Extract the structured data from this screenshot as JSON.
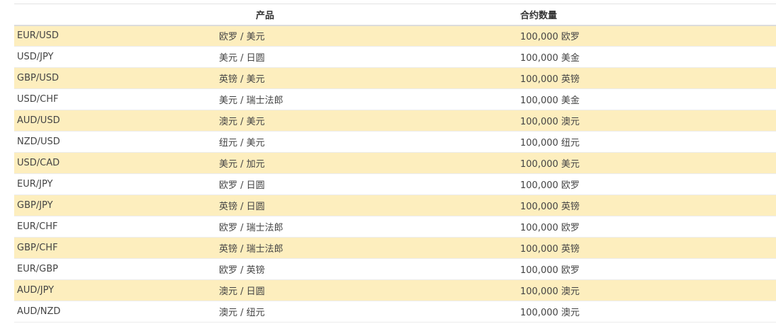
{
  "table": {
    "headers": {
      "symbol": "",
      "product": "产品",
      "contract_size": "合约数量"
    },
    "rows": [
      {
        "symbol": "EUR/USD",
        "product": "欧罗 / 美元",
        "contract_size": "100,000 欧罗"
      },
      {
        "symbol": "USD/JPY",
        "product": "美元 / 日圆",
        "contract_size": "100,000 美金"
      },
      {
        "symbol": "GBP/USD",
        "product": "英镑 / 美元",
        "contract_size": "100,000 英镑"
      },
      {
        "symbol": "USD/CHF",
        "product": "美元 / 瑞士法郎",
        "contract_size": "100,000 美金"
      },
      {
        "symbol": "AUD/USD",
        "product": "澳元 / 美元",
        "contract_size": "100,000 澳元"
      },
      {
        "symbol": "NZD/USD",
        "product": "纽元 / 美元",
        "contract_size": "100,000 纽元"
      },
      {
        "symbol": "USD/CAD",
        "product": "美元 / 加元",
        "contract_size": "100,000 美元"
      },
      {
        "symbol": "EUR/JPY",
        "product": "欧罗 / 日圆",
        "contract_size": "100,000 欧罗"
      },
      {
        "symbol": "GBP/JPY",
        "product": "英镑 / 日圆",
        "contract_size": "100,000 英镑"
      },
      {
        "symbol": "EUR/CHF",
        "product": "欧罗 / 瑞士法郎",
        "contract_size": "100,000 欧罗"
      },
      {
        "symbol": "GBP/CHF",
        "product": "英镑 / 瑞士法郎",
        "contract_size": "100,000 英镑"
      },
      {
        "symbol": "EUR/GBP",
        "product": "欧罗 / 英镑",
        "contract_size": "100,000 欧罗"
      },
      {
        "symbol": "AUD/JPY",
        "product": "澳元 / 日圆",
        "contract_size": "100,000 澳元"
      },
      {
        "symbol": "AUD/NZD",
        "product": "澳元 / 纽元",
        "contract_size": "100,000 澳元"
      }
    ]
  },
  "colors": {
    "row_highlight": "#fdeebe",
    "row_plain": "#ffffff"
  }
}
